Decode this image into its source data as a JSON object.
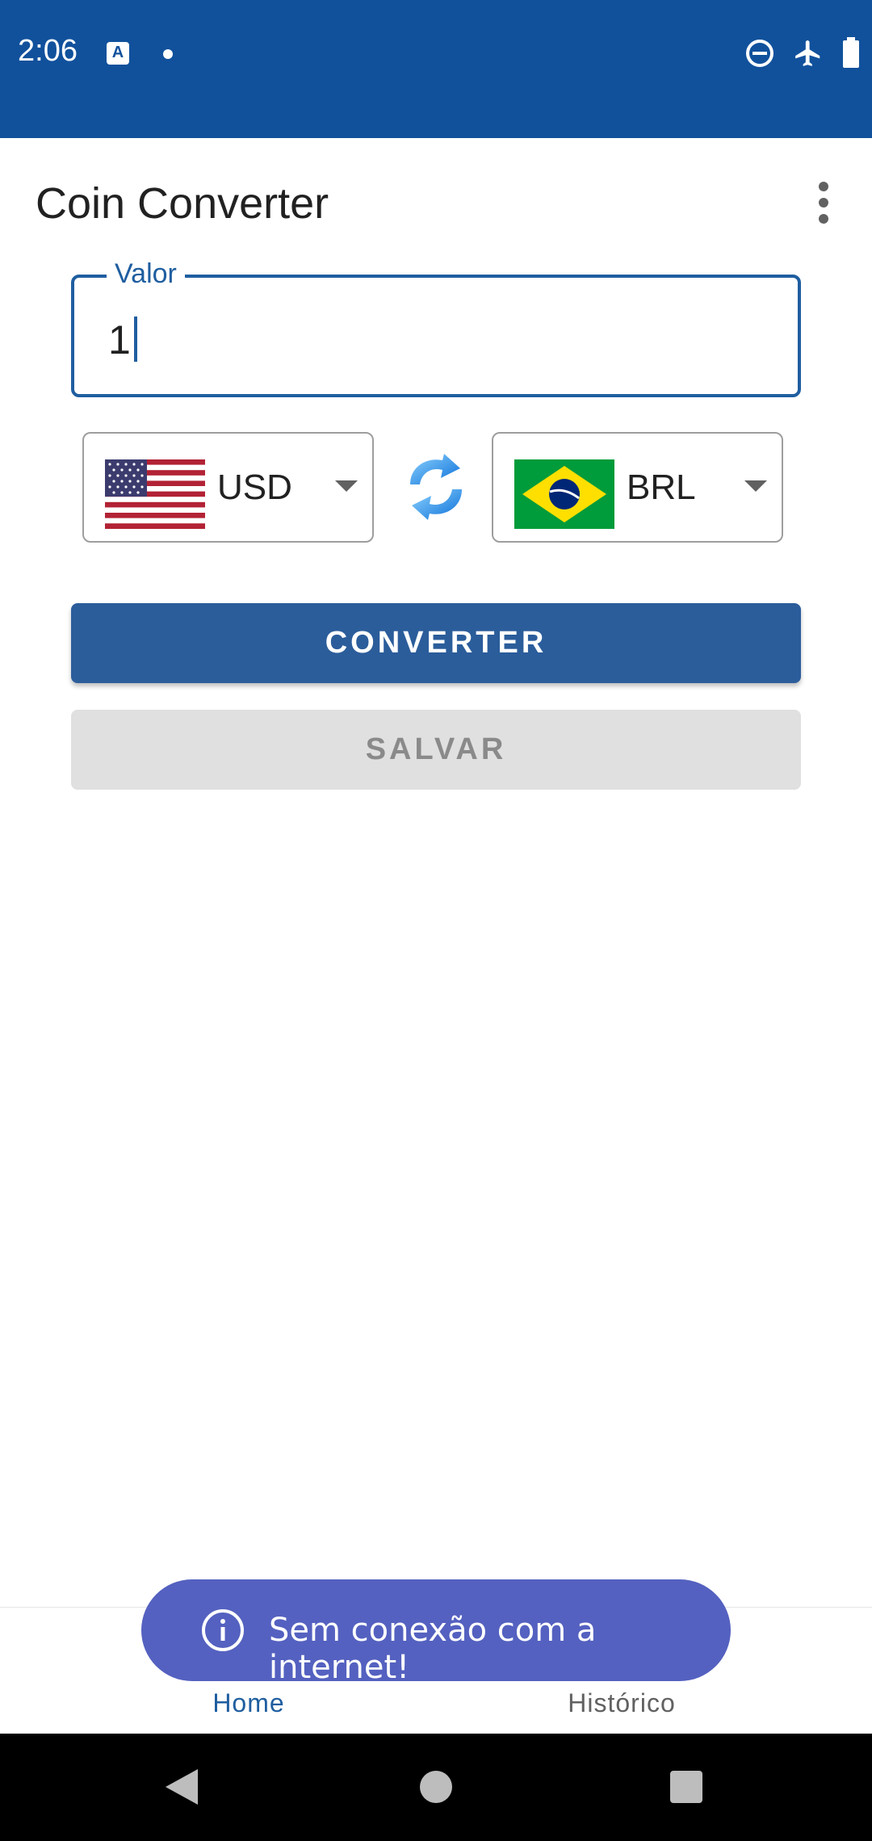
{
  "status_bar": {
    "time": "2:06",
    "notification_icons": [
      "app-notification-icon",
      "dot-icon"
    ],
    "system_icons": [
      "do-not-disturb-icon",
      "airplane-mode-icon",
      "battery-icon"
    ],
    "color": "#11519c"
  },
  "app_bar": {
    "title": "Coin Converter",
    "menu_icon": "more-vert-icon"
  },
  "value_field": {
    "label": "Valor",
    "value": "1"
  },
  "from_currency": {
    "code": "USD",
    "flag": "us-flag-icon"
  },
  "to_currency": {
    "code": "BRL",
    "flag": "brazil-flag-icon"
  },
  "swap_icon": "swap-arrows-icon",
  "buttons": {
    "convert_label": "CONVERTER",
    "save_label": "SALVAR"
  },
  "bottom_nav": {
    "items": [
      {
        "label": "Home",
        "icon": "home-icon",
        "selected": true
      },
      {
        "label": "Histórico",
        "icon": "history-icon",
        "selected": false
      }
    ]
  },
  "snackbar": {
    "icon": "info-icon",
    "text": "Sem conexão com a internet!"
  },
  "colors": {
    "primary": "#2b5d9b",
    "accent": "#1f5ea0",
    "snackbar": "#5461c0",
    "disabled": "#e0e0e0"
  }
}
